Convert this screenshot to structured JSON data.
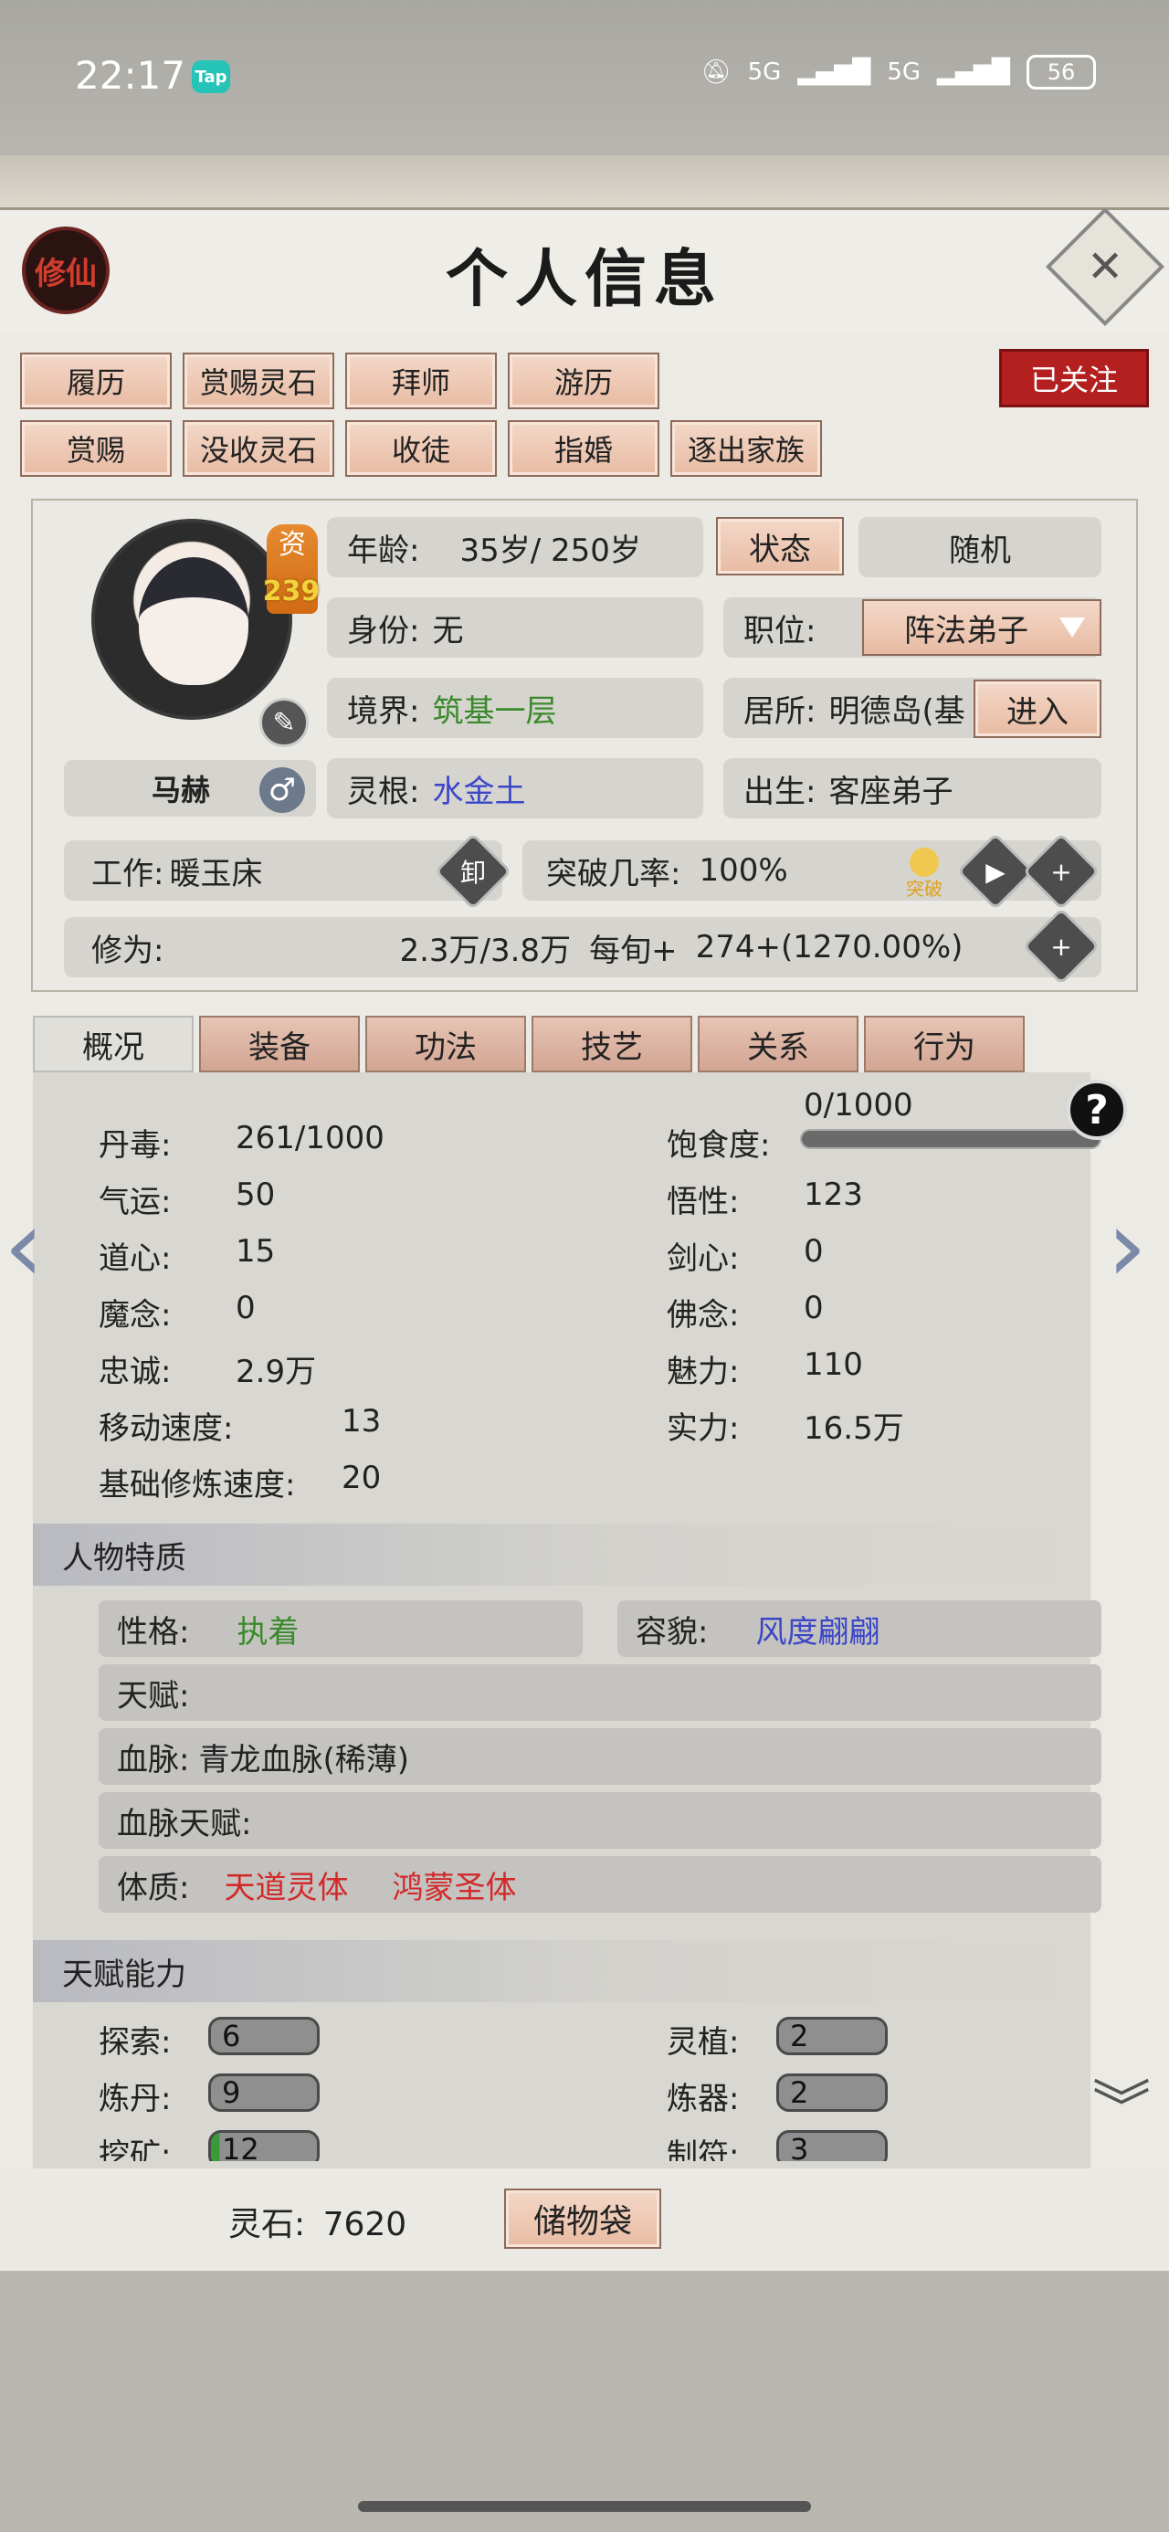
{
  "status_bar": {
    "time": "22:17",
    "tap_label": "Tap",
    "signal1": "5G",
    "signal2": "5G",
    "battery": "56"
  },
  "header": {
    "seal_label": "修仙",
    "title": "个人信息",
    "close_icon": "close-icon"
  },
  "actions": {
    "row1": [
      "履历",
      "赏赐灵石",
      "拜师",
      "游历"
    ],
    "row2": [
      "赏赐",
      "没收灵石",
      "收徒",
      "指婚",
      "逐出家族"
    ],
    "follow": "已关注"
  },
  "profile": {
    "zi_label": "资",
    "zi_value": "239",
    "name": "马赫",
    "gender_icon": "♂",
    "age_label": "年龄:",
    "age_value": "35岁/ 250岁",
    "status_btn": "状态",
    "random_btn": "随机",
    "identity_label": "身份:",
    "identity_value": "无",
    "position_label": "职位:",
    "position_value": "阵法弟子",
    "realm_label": "境界:",
    "realm_value": "筑基一层",
    "residence_label": "居所:",
    "residence_value": "明德岛(基",
    "enter_btn": "进入",
    "root_label": "灵根:",
    "root_value": "水金土",
    "birth_label": "出生:",
    "birth_value": "客座弟子",
    "work_label": "工作:",
    "work_value": "暖玉床",
    "unload_label": "卸",
    "breakthrough_label": "突破几率:",
    "breakthrough_value": "100%",
    "breakthrough_icon_label": "突破",
    "cultivation_label": "修为:",
    "cultivation_value": "2.3万/3.8万",
    "per_turn_label": "每旬+",
    "per_turn_value": "274+(1270.00%)"
  },
  "tabs": [
    "概况",
    "装备",
    "功法",
    "技艺",
    "关系",
    "行为"
  ],
  "stats": {
    "left": [
      {
        "label": "丹毒:",
        "value": "261/1000"
      },
      {
        "label": "气运:",
        "value": "50"
      },
      {
        "label": "道心:",
        "value": "15"
      },
      {
        "label": "魔念:",
        "value": "0"
      },
      {
        "label": "忠诚:",
        "value": "2.9万"
      },
      {
        "label": "移动速度:",
        "value": "13"
      },
      {
        "label": "基础修炼速度:",
        "value": "20"
      }
    ],
    "right": [
      {
        "label": "饱食度:",
        "value": "0/1000"
      },
      {
        "label": "悟性:",
        "value": "123"
      },
      {
        "label": "剑心:",
        "value": "0"
      },
      {
        "label": "佛念:",
        "value": "0"
      },
      {
        "label": "魅力:",
        "value": "110"
      },
      {
        "label": "实力:",
        "value": "16.5万"
      }
    ],
    "hunger_fraction": 0.0
  },
  "traits": {
    "title": "人物特质",
    "personality_label": "性格:",
    "personality_value": "执着",
    "appearance_label": "容貌:",
    "appearance_value": "风度翩翩",
    "talent_label": "天赋:",
    "bloodline_label": "血脉:",
    "bloodline_value": "青龙血脉(稀薄)",
    "bloodline_talent_label": "血脉天赋:",
    "physique_label": "体质:",
    "physique_1": "天道灵体",
    "physique_2": "鸿蒙圣体"
  },
  "abilities": {
    "title": "天赋能力",
    "items": [
      {
        "label": "探索:",
        "value": "6"
      },
      {
        "label": "灵植:",
        "value": "2"
      },
      {
        "label": "炼丹:",
        "value": "9"
      },
      {
        "label": "炼器:",
        "value": "2"
      },
      {
        "label": "挖矿:",
        "value": "12"
      },
      {
        "label": "制符:",
        "value": "3"
      }
    ]
  },
  "footer": {
    "spirit_stone_label": "灵石:",
    "spirit_stone_value": "7620",
    "bag_btn": "储物袋"
  },
  "colors": {
    "accent_button": "#e8bba3",
    "follow_red": "#b41f1f",
    "realm_green": "#3a8a2c",
    "root_blue": "#3c47c8",
    "physique_red": "#d22a2a"
  }
}
